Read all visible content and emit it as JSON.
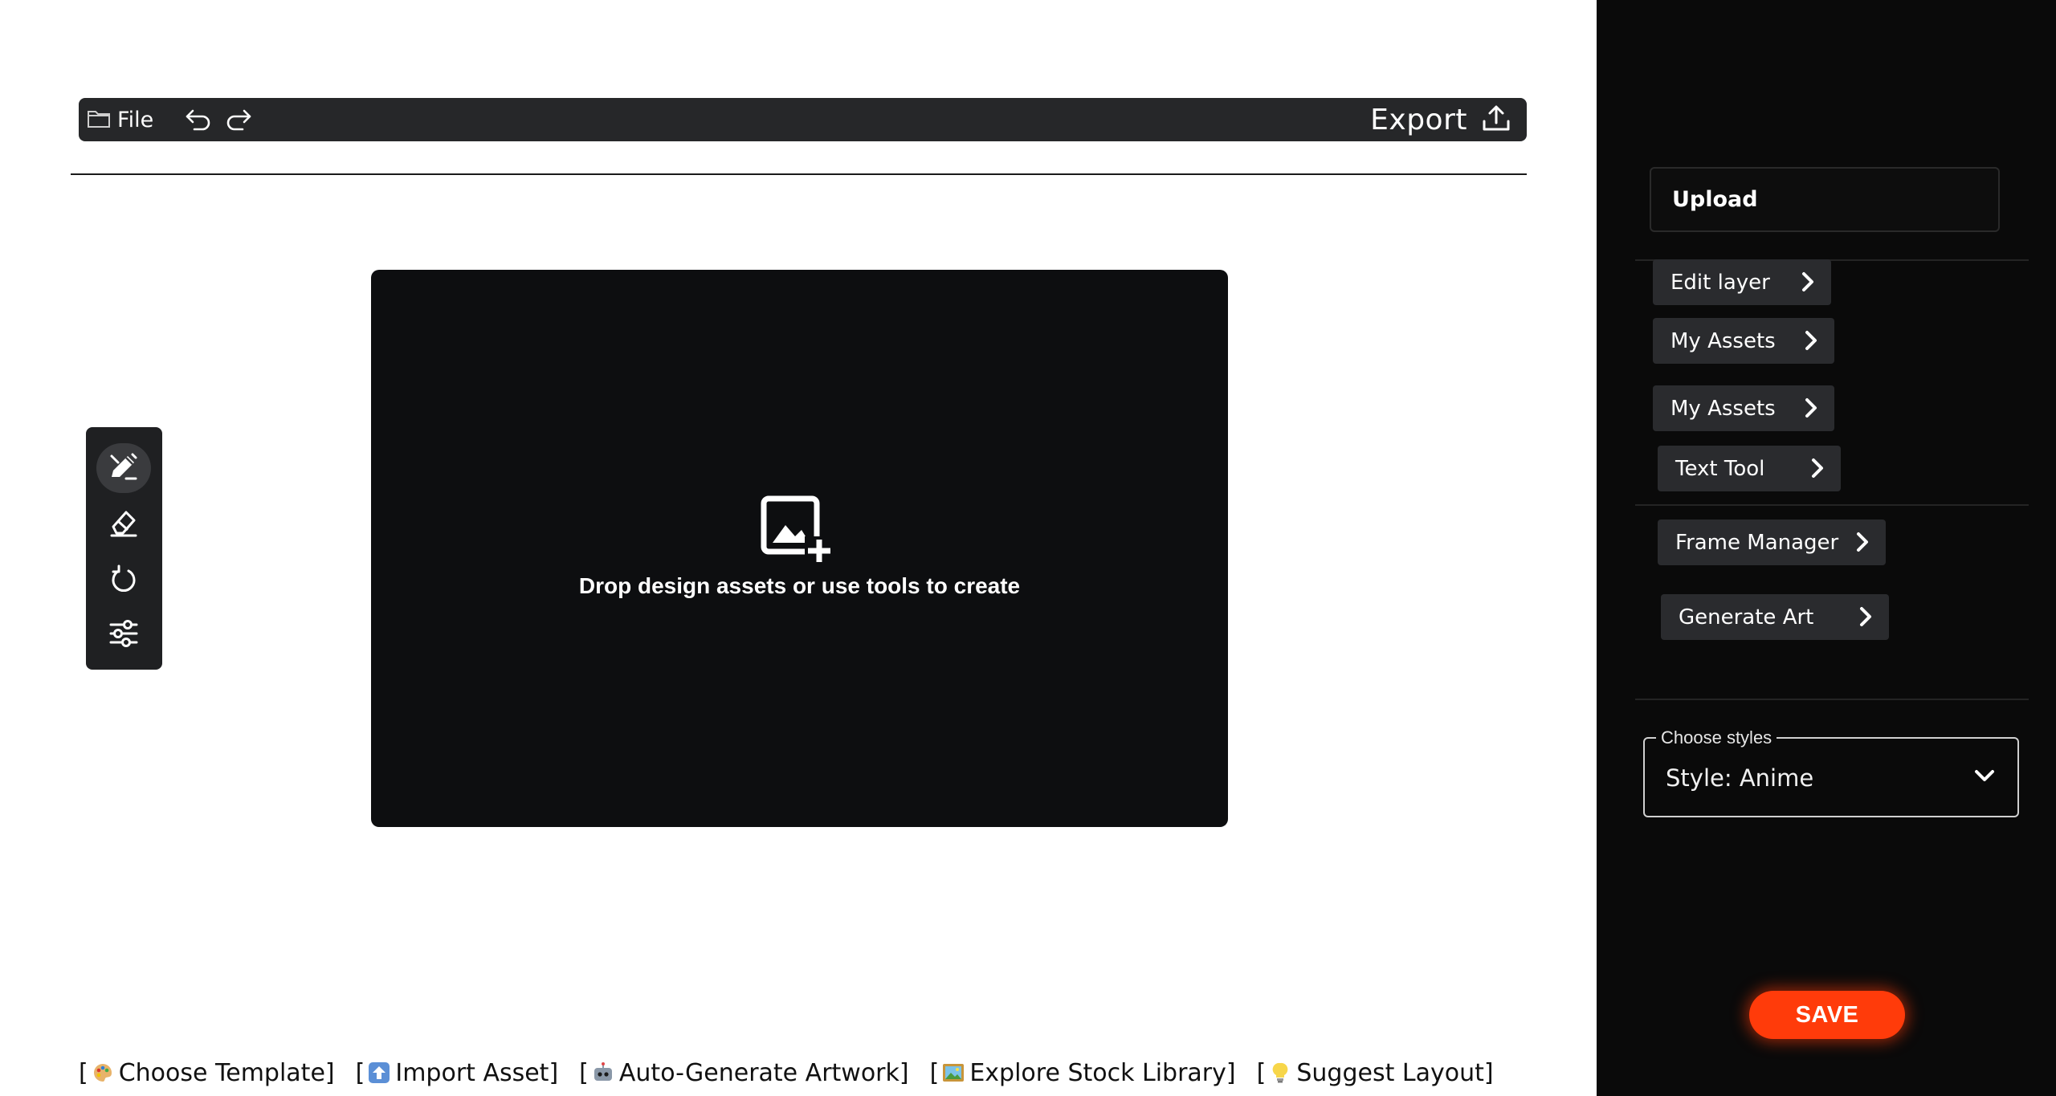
{
  "toolbar": {
    "file_label": "File",
    "export_label": "Export",
    "icons": {
      "file": "folder-icon",
      "undo": "undo-icon",
      "redo": "redo-icon",
      "export": "upload-icon"
    }
  },
  "canvas": {
    "hint": "Drop design assets or use tools to create",
    "icon": "add-image-icon",
    "background": "#0d0e10"
  },
  "tools": [
    {
      "name": "draw-edit-icon",
      "active": true
    },
    {
      "name": "eraser-icon",
      "active": false
    },
    {
      "name": "rotate-icon",
      "active": false
    },
    {
      "name": "sliders-icon",
      "active": false
    }
  ],
  "quick_actions": [
    {
      "label": "Choose Template",
      "icon": "palette-emoji"
    },
    {
      "label": "Import Asset",
      "icon": "up-arrow-emoji"
    },
    {
      "label": "Auto-Generate Artwork",
      "icon": "robot-emoji"
    },
    {
      "label": "Explore Stock Library",
      "icon": "framed-picture-emoji"
    },
    {
      "label": "Suggest Layout",
      "icon": "lightbulb-emoji"
    }
  ],
  "sidebar": {
    "upload_label": "Upload",
    "items": [
      {
        "label": "Edit layer"
      },
      {
        "label": "My Assets"
      },
      {
        "label": "My Assets"
      },
      {
        "label": "Text Tool"
      },
      {
        "label": "Frame Manager"
      },
      {
        "label": "Generate Art"
      }
    ],
    "style_select": {
      "legend": "Choose styles",
      "value": "Style: Anime"
    },
    "save_label": "SAVE"
  },
  "colors": {
    "toolbar_bg": "#262729",
    "sidebar_bg": "#0a0a0a",
    "pill_bg": "#2a2b2e",
    "accent": "#ff3b0a"
  }
}
